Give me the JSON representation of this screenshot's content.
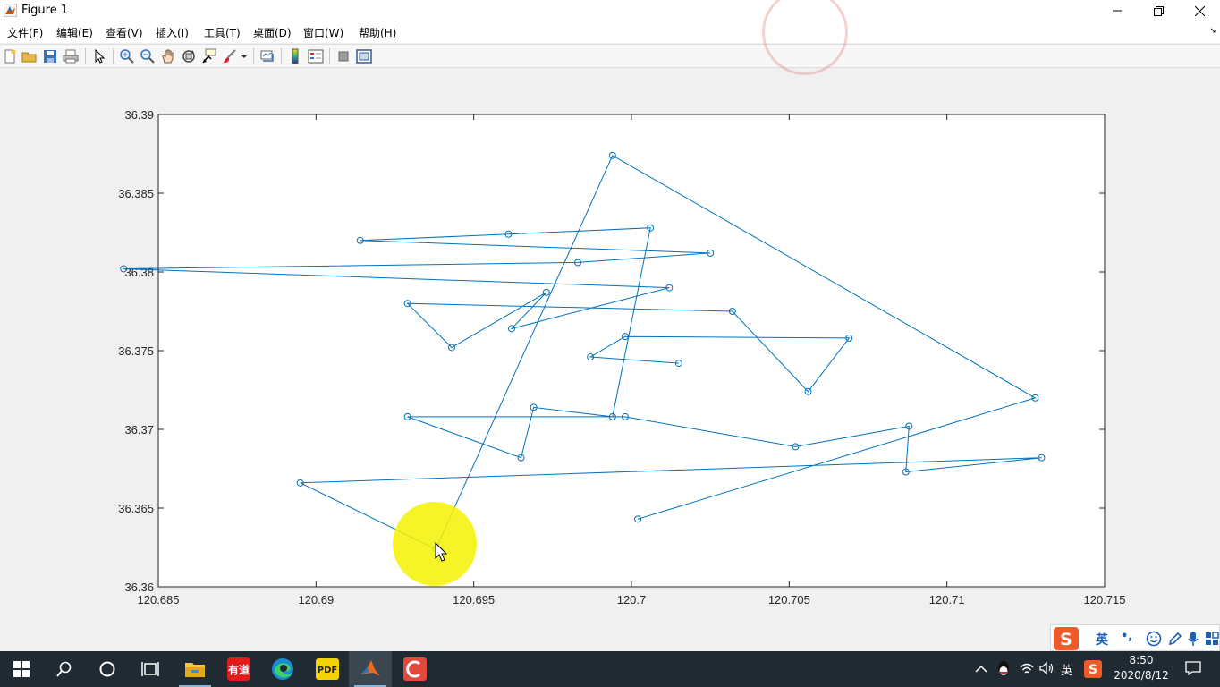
{
  "window": {
    "title": "Figure 1"
  },
  "menu": [
    "文件(F)",
    "编辑(E)",
    "查看(V)",
    "插入(I)",
    "工具(T)",
    "桌面(D)",
    "窗口(W)",
    "帮助(H)"
  ],
  "toolbar_icons": [
    "new-figure-icon",
    "open-file-icon",
    "save-icon",
    "print-icon",
    "select-arrow-icon",
    "zoom-in-icon",
    "zoom-out-icon",
    "pan-hand-icon",
    "rotate-3d-icon",
    "data-cursor-icon",
    "brush-icon",
    "link-plot-icon",
    "insert-colorbar-icon",
    "insert-legend-icon",
    "hide-plot-tools-icon",
    "show-plot-tools-icon"
  ],
  "chart_data": {
    "type": "line",
    "marker": "circle",
    "color": "#0072bd",
    "xlim": [
      120.685,
      120.715
    ],
    "ylim": [
      36.36,
      36.39
    ],
    "xticks": [
      "120.685",
      "120.69",
      "120.695",
      "120.7",
      "120.705",
      "120.71",
      "120.715"
    ],
    "yticks": [
      "36.36",
      "36.365",
      "36.37",
      "36.375",
      "36.38",
      "36.385",
      "36.39"
    ],
    "x": [
      120.7015,
      120.6987,
      120.6998,
      120.7069,
      120.7056,
      120.7032,
      120.6929,
      120.6943,
      120.6973,
      120.6962,
      120.7012,
      120.6839,
      120.6983,
      120.7025,
      120.6914,
      120.6961,
      120.7006,
      120.6994,
      120.6969,
      120.6965,
      120.6929,
      120.6998,
      120.7052,
      120.7088,
      120.7087,
      120.713,
      120.6895,
      120.6938,
      120.6994,
      120.7128,
      120.7002
    ],
    "y": [
      36.3742,
      36.3746,
      36.3759,
      36.3758,
      36.3724,
      36.3775,
      36.378,
      36.3752,
      36.3787,
      36.3764,
      36.379,
      36.3802,
      36.3806,
      36.3812,
      36.382,
      36.3824,
      36.3828,
      36.3708,
      36.3714,
      36.3682,
      36.3708,
      36.3708,
      36.3689,
      36.3702,
      36.3673,
      36.3682,
      36.3666,
      36.3624,
      36.3874,
      36.372,
      36.3643
    ]
  },
  "ime": {
    "lang": "英",
    "punct": "•,",
    "icons": [
      "sogou-logo-icon",
      "emoji-icon",
      "handwrite-icon",
      "microphone-icon",
      "toolbox-icon"
    ]
  },
  "taskbar": {
    "apps": [
      "windows-start-icon",
      "search-icon",
      "cortana-icon",
      "task-view-icon",
      "file-explorer-icon",
      "youdao-icon",
      "edge-icon",
      "pdf-icon",
      "matlab-icon",
      "screen-recorder-icon"
    ],
    "tray_lang": "英",
    "time": "8:50",
    "date": "2020/8/12"
  }
}
